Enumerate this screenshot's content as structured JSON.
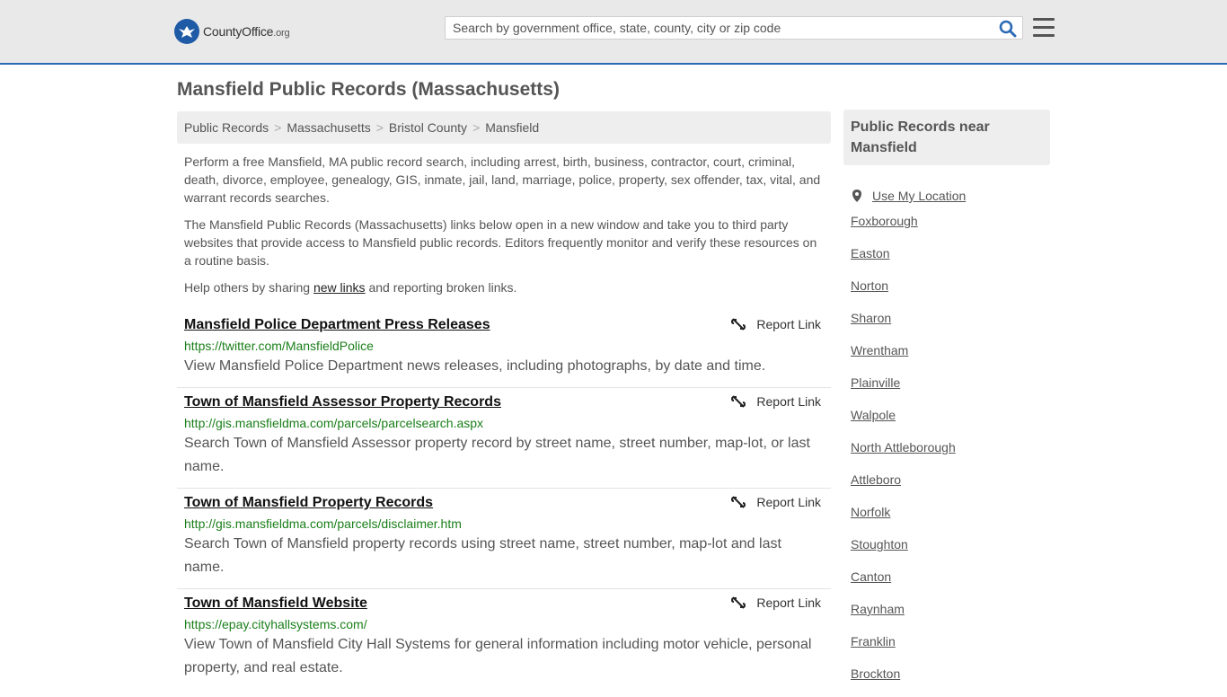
{
  "header": {
    "logo_text": "CountyOffice",
    "logo_suffix": ".org",
    "search_placeholder": "Search by government office, state, county, city or zip code"
  },
  "page_title": "Mansfield Public Records (Massachusetts)",
  "breadcrumb": [
    "Public Records",
    "Massachusetts",
    "Bristol County",
    "Mansfield"
  ],
  "intro": {
    "p1": "Perform a free Mansfield, MA public record search, including arrest, birth, business, contractor, court, criminal, death, divorce, employee, genealogy, GIS, inmate, jail, land, marriage, police, property, sex offender, tax, vital, and warrant records searches.",
    "p2": "The Mansfield Public Records (Massachusetts) links below open in a new window and take you to third party websites that provide access to Mansfield public records. Editors frequently monitor and verify these resources on a routine basis.",
    "p3_before": "Help others by sharing ",
    "p3_link": "new links",
    "p3_after": " and reporting broken links."
  },
  "report_label": "Report Link",
  "records": [
    {
      "title": "Mansfield Police Department Press Releases",
      "url": "https://twitter.com/MansfieldPolice",
      "desc": "View Mansfield Police Department news releases, including photographs, by date and time."
    },
    {
      "title": "Town of Mansfield Assessor Property Records",
      "url": "http://gis.mansfieldma.com/parcels/parcelsearch.aspx",
      "desc": "Search Town of Mansfield Assessor property record by street name, street number, map-lot, or last name."
    },
    {
      "title": "Town of Mansfield Property Records",
      "url": "http://gis.mansfieldma.com/parcels/disclaimer.htm",
      "desc": "Search Town of Mansfield property records using street name, street number, map-lot and last name."
    },
    {
      "title": "Town of Mansfield Website",
      "url": "https://epay.cityhallsystems.com/",
      "desc": "View Town of Mansfield City Hall Systems for general information including motor vehicle, personal property, and real estate."
    }
  ],
  "sidebar": {
    "heading": "Public Records near Mansfield",
    "use_location": "Use My Location",
    "places": [
      "Foxborough",
      "Easton",
      "Norton",
      "Sharon",
      "Wrentham",
      "Plainville",
      "Walpole",
      "North Attleborough",
      "Attleboro",
      "Norfolk",
      "Stoughton",
      "Canton",
      "Raynham",
      "Franklin",
      "Brockton"
    ]
  },
  "colors": {
    "accent": "#2b6ab4",
    "url_green": "#1a7f1a",
    "panel_gray": "#eeeeee",
    "header_gray": "#e9e9e9"
  }
}
